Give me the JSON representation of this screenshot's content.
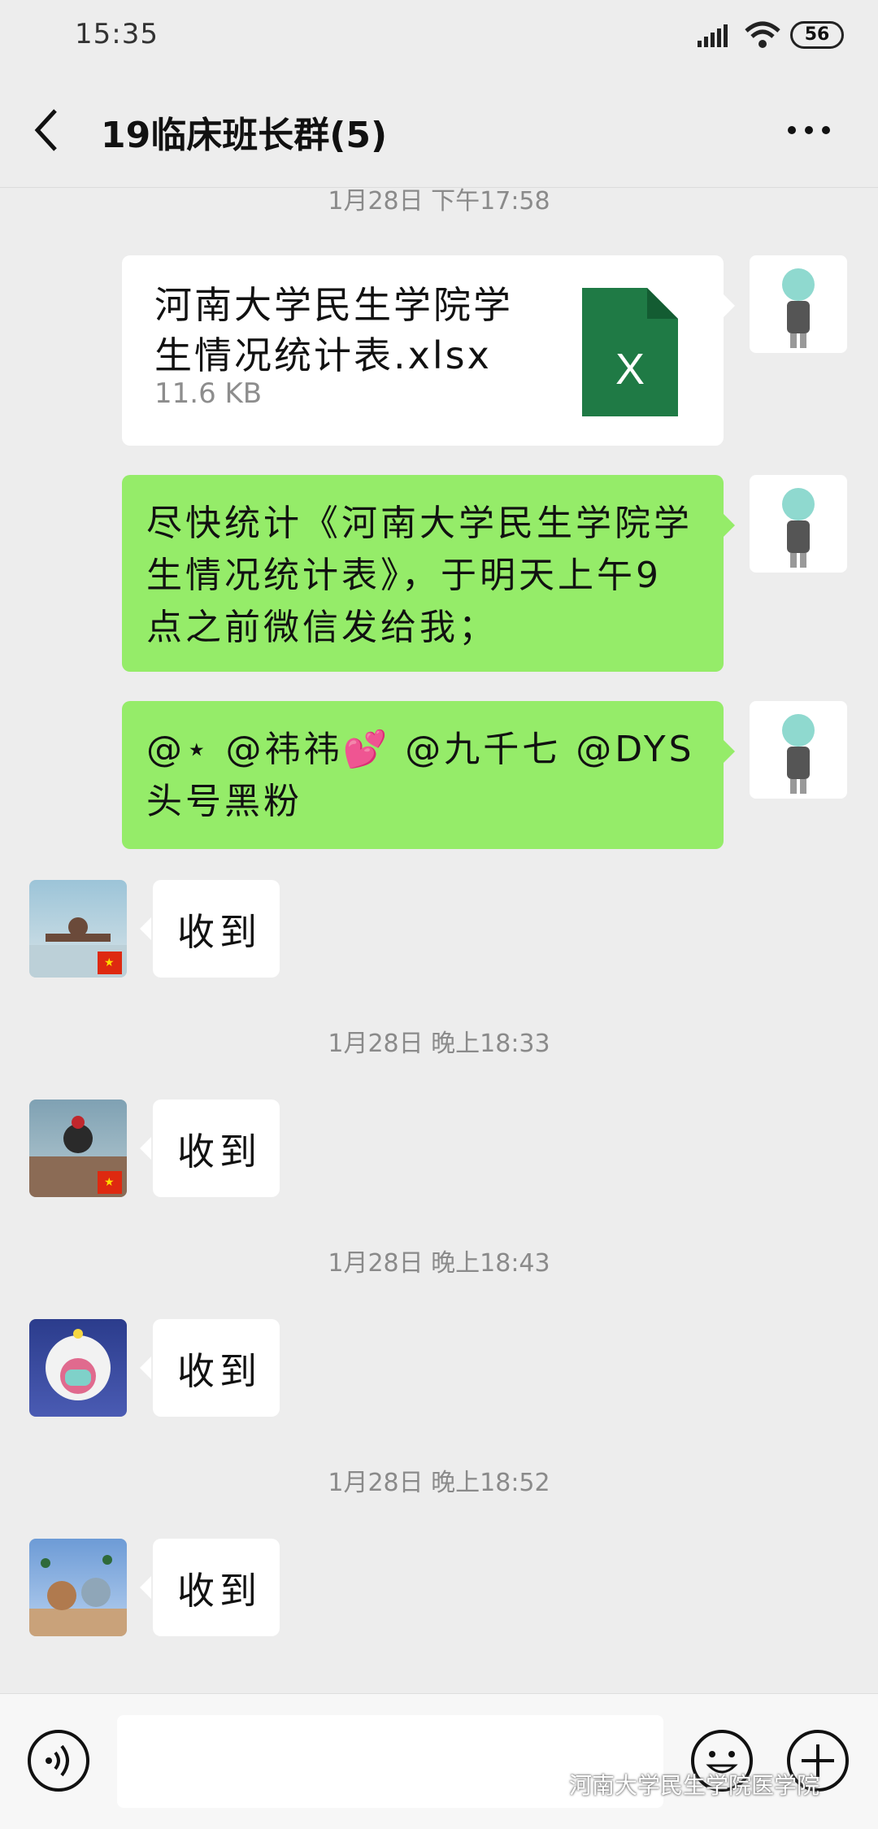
{
  "status_bar": {
    "time": "15:35",
    "battery": "56"
  },
  "header": {
    "title": "19临床班长群(5)"
  },
  "messages": {
    "ts0": "1月28日 下午17:58",
    "file": {
      "name": "河南大学民生学院学生情况统计表.xlsx",
      "size": "11.6 KB",
      "icon_letter": "X"
    },
    "text1": "尽快统计《河南大学民生学院学生情况统计表》，于明天上午9点之前微信发给我；",
    "text2": "@⋆ @祎祎💕 @九千七 @DYS 头号黑粉",
    "recv1": "收到",
    "ts1": "1月28日 晚上18:33",
    "recv2": "收到",
    "ts2": "1月28日 晚上18:43",
    "recv3": "收到",
    "ts3": "1月28日 晚上18:52",
    "recv4": "收到"
  },
  "watermark": "河南大学民生学院医学院",
  "colors": {
    "bg": "#ededed",
    "green_bubble": "#95ec69",
    "excel": "#1f7a45"
  },
  "icons": [
    "back-icon",
    "more-icon",
    "signal-icon",
    "wifi-icon",
    "voice-icon",
    "emoji-icon",
    "plus-icon",
    "excel-file-icon"
  ]
}
